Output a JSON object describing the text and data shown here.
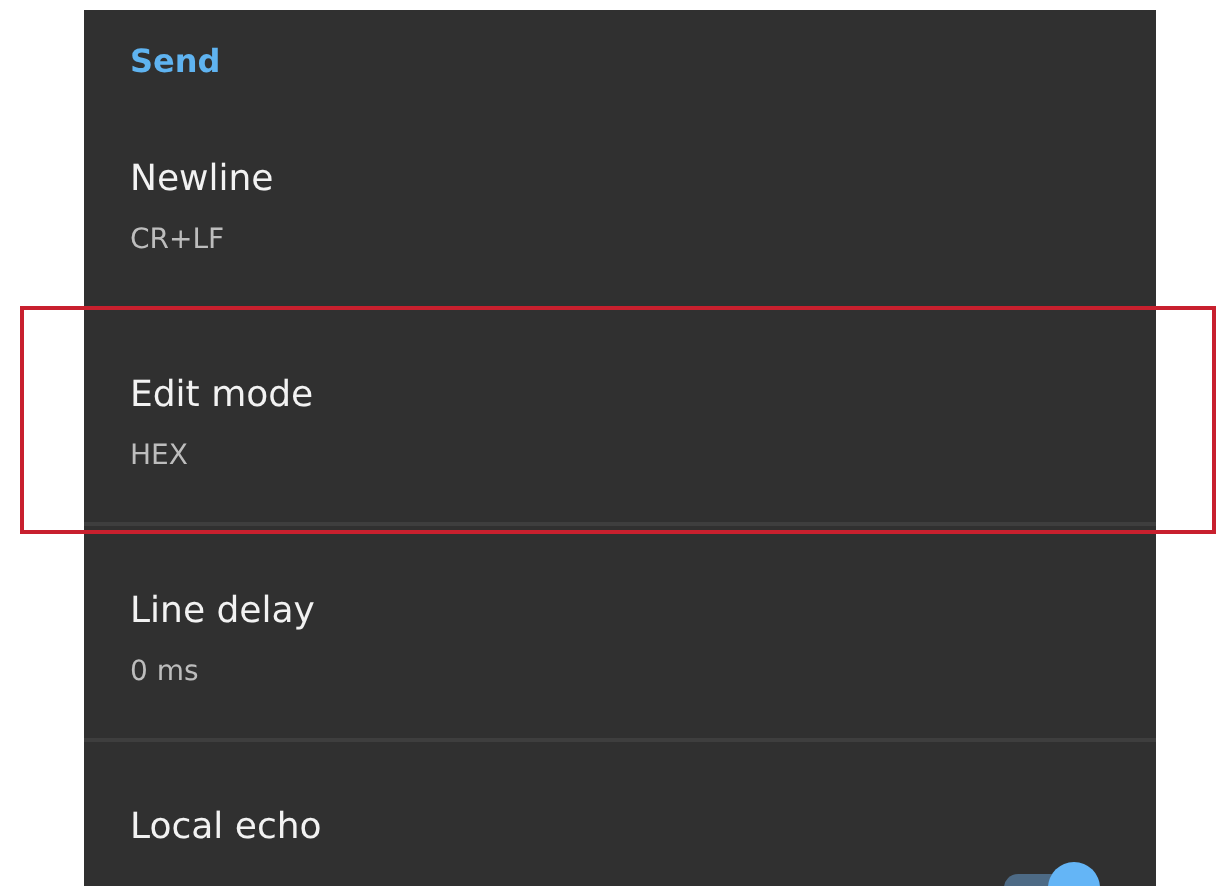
{
  "section": {
    "title": "Send"
  },
  "items": [
    {
      "kind": "value",
      "title": "Newline",
      "value": "CR+LF",
      "highlighted": false
    },
    {
      "kind": "value",
      "title": "Edit mode",
      "value": "HEX",
      "highlighted": true
    },
    {
      "kind": "value",
      "title": "Line delay",
      "value": "0 ms",
      "highlighted": false
    },
    {
      "kind": "toggle",
      "title": "Local echo",
      "on": true,
      "highlighted": false
    }
  ]
}
